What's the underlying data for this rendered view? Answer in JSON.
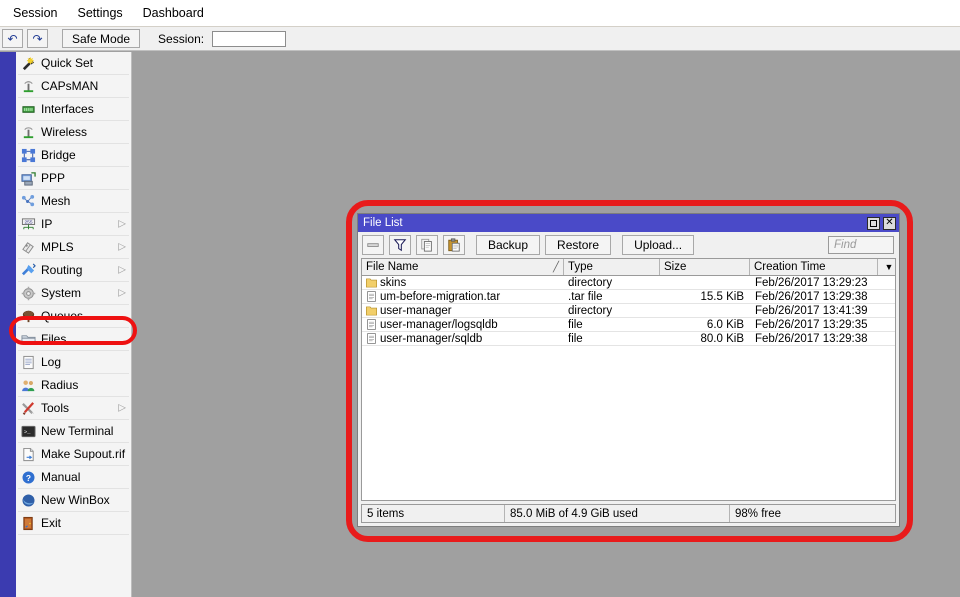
{
  "menubar": {
    "items": [
      {
        "label": "Session"
      },
      {
        "label": "Settings"
      },
      {
        "label": "Dashboard"
      }
    ]
  },
  "toolbar": {
    "undo_icon": "undo-arrow-icon",
    "redo_icon": "redo-arrow-icon",
    "undo_glyph": "↶",
    "redo_glyph": "↷",
    "safe_mode_label": "Safe Mode",
    "session_label": "Session:",
    "session_value": ""
  },
  "sidebar": {
    "items": [
      {
        "label": "Quick Set",
        "icon": "quick-set-icon",
        "submenu": false
      },
      {
        "label": "CAPsMAN",
        "icon": "capsman-icon",
        "submenu": false
      },
      {
        "label": "Interfaces",
        "icon": "interfaces-icon",
        "submenu": false
      },
      {
        "label": "Wireless",
        "icon": "wireless-icon",
        "submenu": false
      },
      {
        "label": "Bridge",
        "icon": "bridge-icon",
        "submenu": false
      },
      {
        "label": "PPP",
        "icon": "ppp-icon",
        "submenu": false
      },
      {
        "label": "Mesh",
        "icon": "mesh-icon",
        "submenu": false
      },
      {
        "label": "IP",
        "icon": "ip-icon",
        "submenu": true
      },
      {
        "label": "MPLS",
        "icon": "mpls-icon",
        "submenu": true
      },
      {
        "label": "Routing",
        "icon": "routing-icon",
        "submenu": true
      },
      {
        "label": "System",
        "icon": "system-gear-icon",
        "submenu": true
      },
      {
        "label": "Queues",
        "icon": "queues-icon",
        "submenu": false
      },
      {
        "label": "Files",
        "icon": "folder-icon",
        "submenu": false
      },
      {
        "label": "Log",
        "icon": "log-icon",
        "submenu": false
      },
      {
        "label": "Radius",
        "icon": "radius-users-icon",
        "submenu": false
      },
      {
        "label": "Tools",
        "icon": "tools-icon",
        "submenu": true
      },
      {
        "label": "New Terminal",
        "icon": "terminal-icon",
        "submenu": false
      },
      {
        "label": "Make Supout.rif",
        "icon": "supout-file-icon",
        "submenu": false
      },
      {
        "label": "Manual",
        "icon": "manual-help-icon",
        "submenu": false
      },
      {
        "label": "New WinBox",
        "icon": "winbox-globe-icon",
        "submenu": false
      },
      {
        "label": "Exit",
        "icon": "exit-door-icon",
        "submenu": false
      }
    ],
    "highlight_color": "#ee1111",
    "highlighted_item": "Files"
  },
  "filelist": {
    "title": "File List",
    "window_highlight_color": "#e81b1b",
    "titlebar_color": "#4a4ac8",
    "window_buttons": [
      {
        "name": "restore-button",
        "glyph": ""
      },
      {
        "name": "close-button",
        "glyph": "✕"
      }
    ],
    "toolbar": {
      "remove_icon": "minus-remove-icon",
      "filter_icon": "filter-funnel-icon",
      "copy_icon": "copy-icon",
      "paste_icon": "paste-clipboard-icon",
      "backup_label": "Backup",
      "restore_label": "Restore",
      "upload_label": "Upload...",
      "find_placeholder": "Find",
      "find_value": ""
    },
    "columns": [
      {
        "label": "File Name",
        "sorted": true,
        "sortmark": "╱"
      },
      {
        "label": "Type",
        "sorted": false,
        "sortmark": ""
      },
      {
        "label": "Size",
        "sorted": false,
        "sortmark": ""
      },
      {
        "label": "Creation Time",
        "sorted": false,
        "sortmark": ""
      }
    ],
    "column_dropdown_glyph": "▼",
    "rows": [
      {
        "name": "skins",
        "icon": "folder-icon",
        "indent": false,
        "type": "directory",
        "size": "",
        "time": "Feb/26/2017 13:29:23"
      },
      {
        "name": "um-before-migration.tar",
        "icon": "file-icon",
        "indent": false,
        "type": ".tar file",
        "size": "15.5 KiB",
        "time": "Feb/26/2017 13:29:38"
      },
      {
        "name": "user-manager",
        "icon": "folder-icon",
        "indent": false,
        "type": "directory",
        "size": "",
        "time": "Feb/26/2017 13:41:39"
      },
      {
        "name": "user-manager/logsqldb",
        "icon": "file-icon",
        "indent": true,
        "type": "file",
        "size": "6.0 KiB",
        "time": "Feb/26/2017 13:29:35"
      },
      {
        "name": "user-manager/sqldb",
        "icon": "file-icon",
        "indent": true,
        "type": "file",
        "size": "80.0 KiB",
        "time": "Feb/26/2017 13:29:38"
      }
    ],
    "statusbar": {
      "items_count": "5 items",
      "space_used": "85.0 MiB of 4.9 GiB used",
      "free_percent": "98% free"
    }
  }
}
